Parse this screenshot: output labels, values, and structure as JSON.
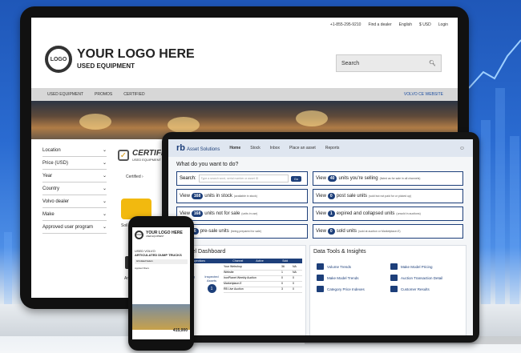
{
  "monitor": {
    "topbar": [
      "+1-855-295-9210",
      "Find a dealer",
      "English",
      "$ USD",
      "Login"
    ],
    "logo_badge": "LOGO",
    "logo_title": "YOUR LOGO HERE",
    "logo_subtitle": "USED EQUIPMENT",
    "search_placeholder": "Search",
    "nav": [
      "USED EQUIPMENT",
      "PROMOS",
      "CERTIFIED"
    ],
    "nav_right": "VOLVO CE WEBSITE",
    "filters": [
      "Location",
      "Price (USD)",
      "Year",
      "Country",
      "Volvo dealer",
      "Make",
      "Approved user program"
    ],
    "certified_title": "CERTIFIED",
    "certified_sub": "USED EQUIPMENT",
    "certified_link": "Certified ›",
    "roller_caption": "Soil C",
    "second_caption": "Ar"
  },
  "tablet": {
    "brand_rb": "rb",
    "brand_name": "Asset Solutions",
    "nav": [
      "Home",
      "Stock",
      "Inbox",
      "Place an asset",
      "Reports"
    ],
    "question": "What do you want to do?",
    "search_label": "Search:",
    "search_placeholder": "Type a search word, serial number or asset ID",
    "go": "Go",
    "views": [
      {
        "count": "168",
        "text": "units in stock",
        "note": "(available in stock)"
      },
      {
        "count": "168",
        "text": "units not for sale",
        "note": "(units in use)"
      },
      {
        "count": "6",
        "text": "pre-sale units",
        "note": "(being prepared for sale)"
      },
      {
        "count": "40",
        "text": "units you're selling",
        "note": "(listed as for sale in all channels)"
      },
      {
        "count": "0",
        "text": "post sale units",
        "note": "(sold but not paid for or picked up)"
      },
      {
        "count": "1",
        "text": "expired and collapsed units",
        "note": "(unsold in auctions)"
      },
      {
        "count": "0",
        "text": "sold units",
        "note": "(sold at auction or Marketplace-E)"
      }
    ],
    "view_word": "View",
    "channel_title": "Channel Dashboard",
    "channel_headers": [
      "Inspections",
      "Channel",
      "Active",
      "Sold"
    ],
    "channel_rows": [
      [
        "Your Webshop",
        "36",
        "NA"
      ],
      [
        "Website",
        "1",
        "NA"
      ],
      [
        "IronPlanet Weekly Auction",
        "0",
        "0"
      ],
      [
        "Marketplace-E",
        "0",
        "0"
      ],
      [
        "RB Live Auction",
        "3",
        "0"
      ]
    ],
    "inspecting_label": "Inspecting Assets",
    "inspecting_count": "7",
    "inspected_label": "Inspected Assets",
    "inspected_count": "1",
    "tools_title": "Data Tools & Insights",
    "tools": [
      "Volume Trends",
      "Make Model Pricing",
      "Make Model Trends",
      "Auction Transaction Detail",
      "Category Price Indexes",
      "Customer Results"
    ]
  },
  "phone": {
    "logo": "LOGO",
    "title": "YOUR LOGO HERE",
    "subtitle": "USED EQUIPMENT",
    "heading_small": "USED VOLVO",
    "heading": "ARTICULATED DUMP TRUCKS",
    "bar": "Articulated haulers",
    "applied": "Applied filters",
    "price": "415,000"
  }
}
